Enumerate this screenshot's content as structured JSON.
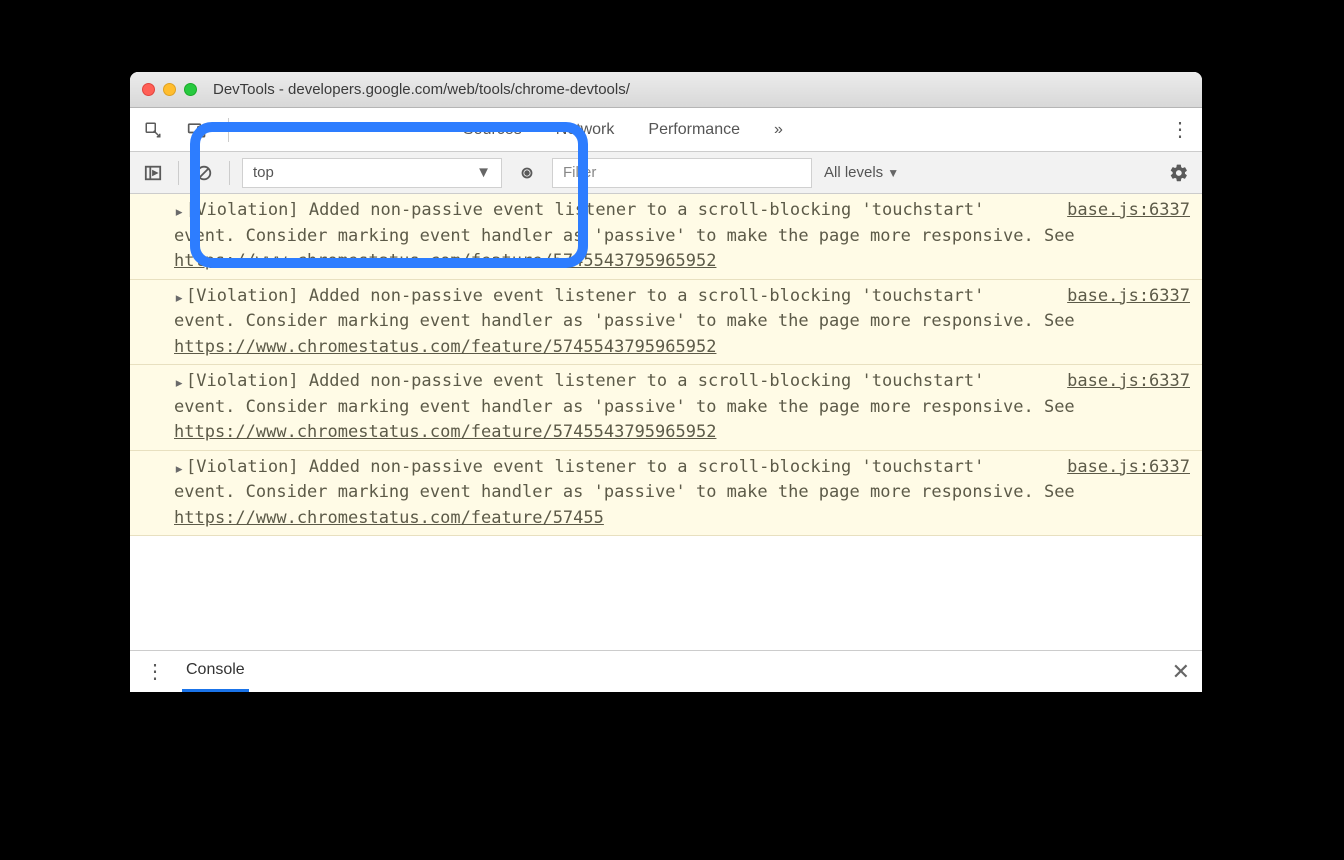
{
  "window": {
    "title": "DevTools - developers.google.com/web/tools/chrome-devtools/"
  },
  "tabs": {
    "sources": "Sources",
    "network": "Network",
    "performance": "Performance",
    "more": "»"
  },
  "toolbar": {
    "context": "top",
    "filter_placeholder": "Filter",
    "levels": "All levels"
  },
  "messages": [
    {
      "prefix": "[Violation]",
      "body_a": " Added non-passive event listener to a scroll-blocking 'touchstart' event. Consider marking event handler as 'passive' to make the page more responsive. See ",
      "link": "https://www.chromestatus.com/feature/5745543795965952",
      "source": "base.js:6337"
    },
    {
      "prefix": "[Violation]",
      "body_a": " Added non-passive event listener to a scroll-blocking 'touchstart' event. Consider marking event handler as 'passive' to make the page more responsive. See ",
      "link": "https://www.chromestatus.com/feature/5745543795965952",
      "source": "base.js:6337"
    },
    {
      "prefix": "[Violation]",
      "body_a": " Added non-passive event listener to a scroll-blocking 'touchstart' event. Consider marking event handler as 'passive' to make the page more responsive. See ",
      "link": "https://www.chromestatus.com/feature/5745543795965952",
      "source": "base.js:6337"
    },
    {
      "prefix": "[Violation]",
      "body_a": " Added non-passive event listener to a scroll-blocking 'touchstart' event. Consider marking event handler as 'passive' to make the page more responsive. See ",
      "link": "https://www.chromestatus.com/feature/57455",
      "source": "base.js:6337"
    }
  ],
  "drawer": {
    "tab": "Console"
  }
}
